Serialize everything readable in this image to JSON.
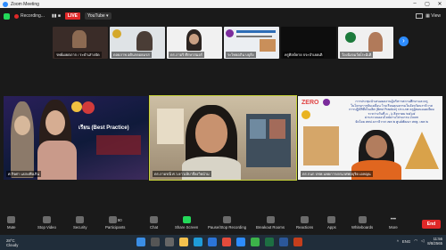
{
  "window": {
    "title": "Zoom Meeting"
  },
  "meeting_bar": {
    "recording": "Recording...",
    "live": "LIVE",
    "stream_target": "YouTube"
  },
  "thumbnails": [
    {
      "name": "รพย์เผยตภาก / ระบำเส่างบัด"
    },
    {
      "name": "ดลยภาพ อดินกดอยมรส"
    },
    {
      "name": "ดร.ภาอริ ศึกษาสมอร์"
    },
    {
      "name": "ระไทยอภิน บบุยิ่ง"
    },
    {
      "name": "ครูศิลป์คาย จระบำเยดเติ"
    },
    {
      "name": "ว้องนิงจมว้ตเ้ระมิเติ"
    }
  ],
  "main_tiles": [
    {
      "name": "ศ.กิจศา แปลงพึงเกิน"
    },
    {
      "name": "ดร.ภาอรณี ศ.ว.ยาวเห้บาจี่ยงวิยนำม"
    },
    {
      "name": "ดร.กนก ปชพ.นพยการ/ดรเภศพบบุริด เอหญน"
    }
  ],
  "slide": {
    "zero": "ZERO",
    "lines": [
      "การประชุมนำเสนอผลงานผู้บริหารสถานศึกษาและครู",
      "ในโครงการขับเคลื่อน โรงเรียนคุณธรรมในจังหวัดนราธิวาส",
      "การปฏิบัติที่เป็นเลิศ (Best Practice) ประเภท ครูผู้สอนยอดเยี่ยม",
      "ระหว่างวันที่ ๓ - ๖ สิงหาคม ๒๕๖๕",
      "ผ่านระบบออนไลน์ผ่านโปรแกรม Zoom",
      "จัดโดย สพป.นราธิวาส เขต ๒ ศูนย์พัฒนา สพฐ. เขต ๒"
    ],
    "left_banner": "เรียน (Best Practice)"
  },
  "toolbar": {
    "items": [
      {
        "label": "Mute"
      },
      {
        "label": "Stop Video"
      },
      {
        "label": "Security"
      },
      {
        "label": "Participants",
        "count": "90"
      },
      {
        "label": "Chat"
      },
      {
        "label": "Share Screen"
      },
      {
        "label": "Pause/Stop Recording"
      },
      {
        "label": "Breakout Rooms"
      },
      {
        "label": "Reactions"
      },
      {
        "label": "Apps"
      },
      {
        "label": "Whiteboards"
      },
      {
        "label": "More"
      }
    ],
    "end": "End"
  },
  "taskbar": {
    "temp": "28°C",
    "weather": "Cloudy",
    "lang": "ENG",
    "time": "11:56",
    "date": "8/8/2565"
  },
  "colors": {
    "accent": "#2d8cff",
    "end": "#e02828",
    "share": "#23d959",
    "active_border": "#c7d23a"
  }
}
